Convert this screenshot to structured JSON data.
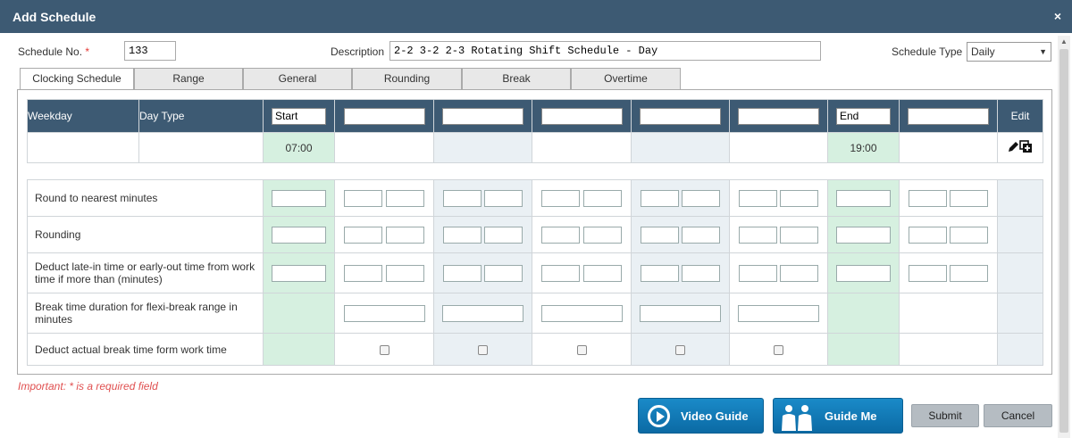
{
  "dialog": {
    "title": "Add Schedule",
    "close_glyph": "×"
  },
  "form": {
    "schedule_no_label": "Schedule No.",
    "required_mark": "*",
    "schedule_no_value": "133",
    "description_label": "Description",
    "description_value": "2-2 3-2 2-3 Rotating Shift Schedule - Day",
    "schedule_type_label": "Schedule Type",
    "schedule_type_value": "Daily"
  },
  "tabs": [
    "Clocking Schedule",
    "Range",
    "General",
    "Rounding",
    "Break",
    "Overtime"
  ],
  "grid": {
    "header": {
      "weekday": "Weekday",
      "day_type": "Day Type",
      "edit": "Edit",
      "slots": [
        "Start",
        "",
        "",
        "",
        "",
        "",
        "End",
        ""
      ]
    },
    "times": [
      "07:00",
      "",
      "",
      "",
      "",
      "",
      "19:00",
      ""
    ]
  },
  "rules": {
    "round_nearest": "Round to nearest minutes",
    "rounding": "Rounding",
    "deduct_late": "Deduct late-in time or early-out time from work time if more than (minutes)",
    "break_duration": "Break time duration for flexi-break range in minutes",
    "deduct_break": "Deduct actual break time form work time"
  },
  "footer": {
    "important_note": "Important: * is a required field",
    "video_guide": "Video Guide",
    "guide_me": "Guide Me",
    "submit": "Submit",
    "cancel": "Cancel"
  },
  "colors": {
    "header": "#3d5a73",
    "accent_green": "#d6f0e0",
    "accent_blue": "#eaf0f4",
    "button_blue": "#1a8ac8"
  }
}
